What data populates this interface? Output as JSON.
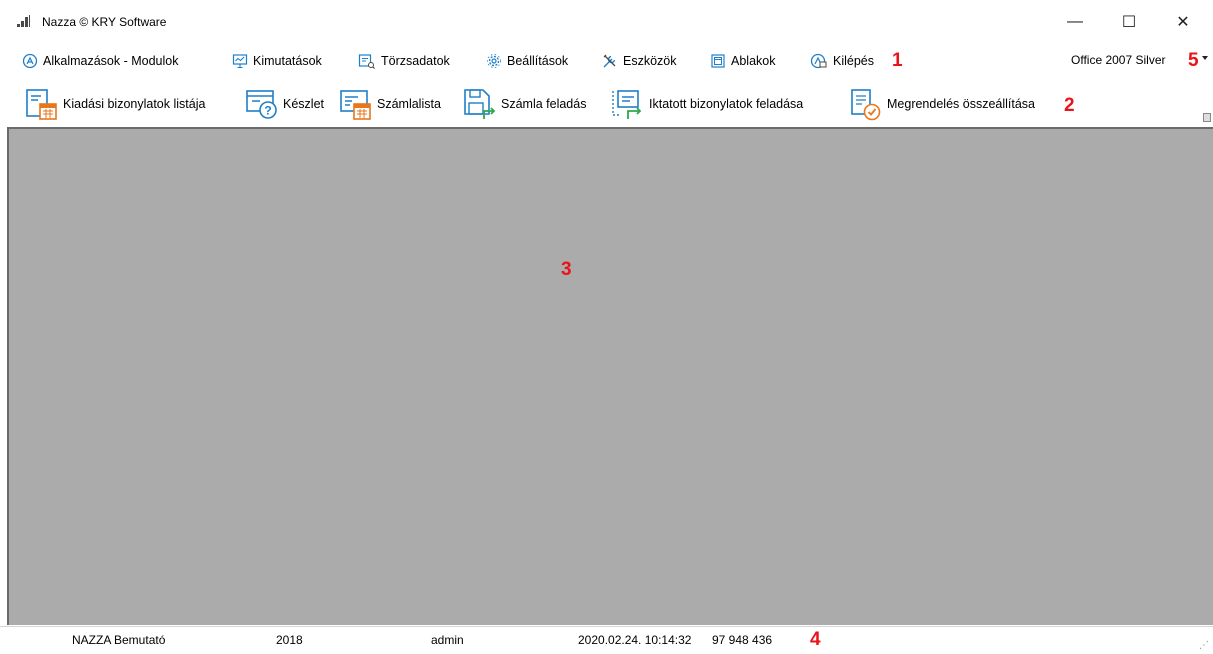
{
  "window": {
    "title": "Nazza © KRY Software",
    "controls": {
      "minimize": "—",
      "maximize": "☐",
      "close": "✕"
    }
  },
  "menu": {
    "items": [
      {
        "label": "Alkalmazások - Modulok",
        "icon": "apps-icon"
      },
      {
        "label": "Kimutatások",
        "icon": "chart-icon"
      },
      {
        "label": "Törzsadatok",
        "icon": "master-data-icon"
      },
      {
        "label": "Beállítások",
        "icon": "gear-icon"
      },
      {
        "label": "Eszközök",
        "icon": "tools-icon"
      },
      {
        "label": "Ablakok",
        "icon": "windows-icon"
      },
      {
        "label": "Kilépés",
        "icon": "exit-icon"
      }
    ],
    "marker": "1"
  },
  "theme": {
    "selected": "Office 2007 Silver",
    "marker": "5"
  },
  "toolbar": {
    "items": [
      {
        "label": "Kiadási bizonylatok listája",
        "icon": "document-calendar-icon"
      },
      {
        "label": "Készlet",
        "icon": "stock-question-icon"
      },
      {
        "label": "Számlalista",
        "icon": "invoice-list-icon"
      },
      {
        "label": "Számla feladás",
        "icon": "invoice-send-icon"
      },
      {
        "label": "Iktatott bizonylatok feladása",
        "icon": "registered-send-icon"
      },
      {
        "label": "Megrendelés összeállítása",
        "icon": "order-check-icon"
      }
    ],
    "marker": "2"
  },
  "workspace": {
    "marker": "3"
  },
  "status": {
    "company": "NAZZA Bemutató",
    "year": "2018",
    "user": "admin",
    "datetime": "2020.02.24. 10:14:32",
    "number": "97 948 436",
    "marker": "4"
  },
  "colors": {
    "accent_blue": "#1e7fc8",
    "accent_orange": "#e8761c",
    "marker_red": "#e8141a",
    "workspace": "#ababab"
  }
}
